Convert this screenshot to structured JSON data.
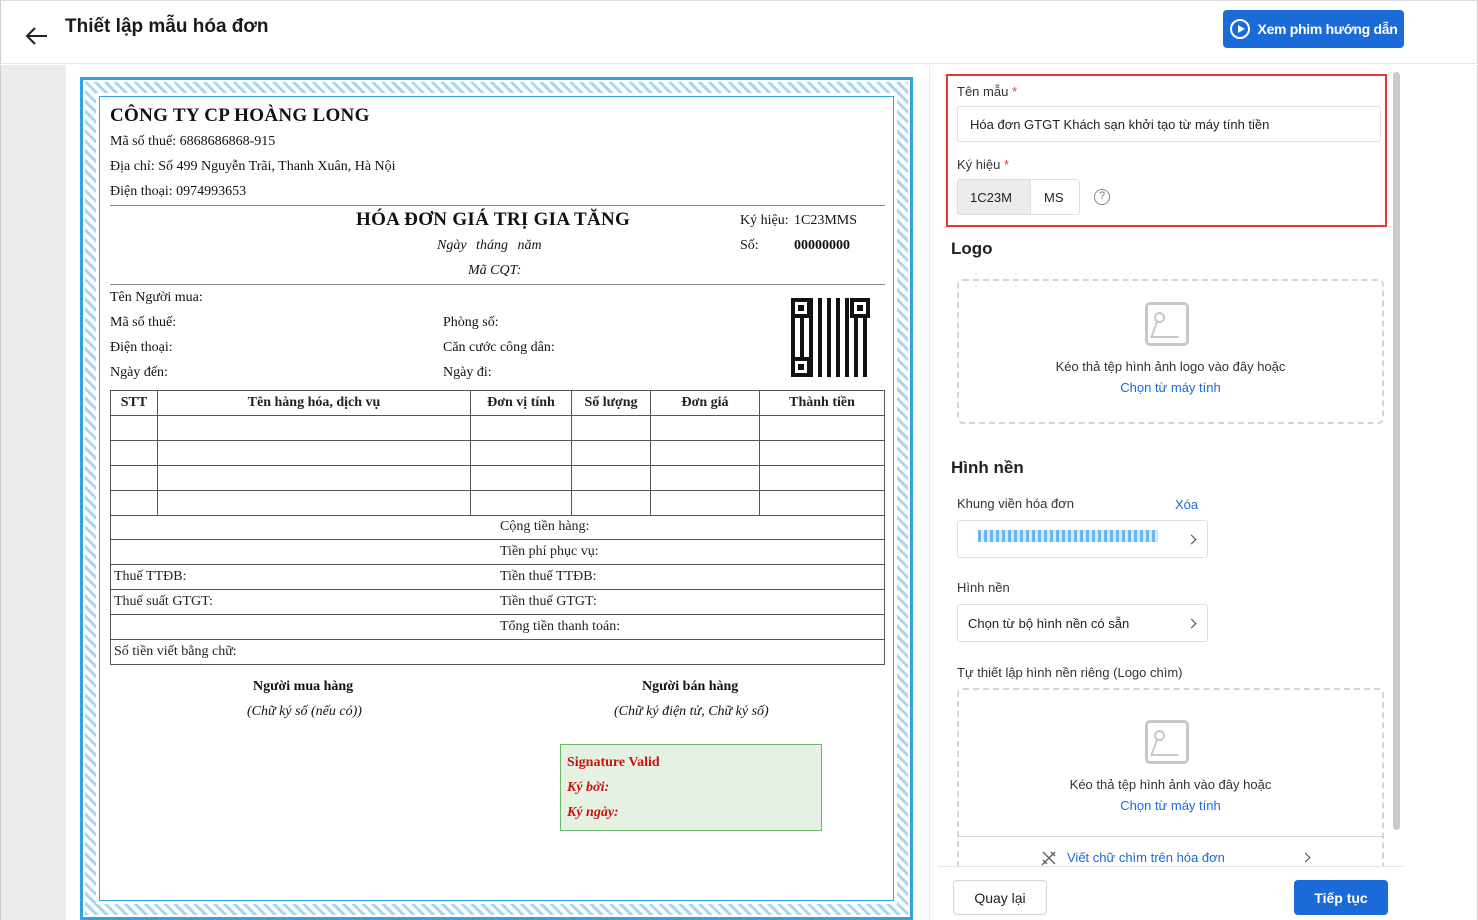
{
  "header": {
    "title": "Thiết lập mẫu hóa đơn",
    "video_button": "Xem phim hướng dẫn"
  },
  "invoice": {
    "company": "CÔNG TY CP HOÀNG LONG",
    "tax_code": "Mã số thuế: 6868686868-915",
    "address": "Địa chỉ: Số 499 Nguyễn Trãi, Thanh Xuân, Hà Nội",
    "phone": "Điện thoại: 0974993653",
    "title": "HÓA ĐƠN GIÁ TRỊ GIA TĂNG",
    "date_line": "Ngày     tháng     năm",
    "cqt_code": "Mã CQT:",
    "symbol_label": "Ký hiệu:",
    "symbol_value": "1C23MMS",
    "number_label": "Số:",
    "number_value": "00000000",
    "buyer_name": "Tên Người mua:",
    "buyer_tax": "Mã số thuế:",
    "buyer_phone": "Điện thoại:",
    "arrival_date": "Ngày đến:",
    "room_no": "Phòng số:",
    "citizen_id": "Căn cước công dân:",
    "departure_date": "Ngày đi:",
    "table_headers": [
      "STT",
      "Tên hàng hóa, dịch vụ",
      "Đơn vị tính",
      "Số lượng",
      "Đơn giá",
      "Thành tiền"
    ],
    "subtotal": "Cộng tiền hàng:",
    "service_fee": "Tiền phí phục vụ:",
    "special_tax": "Thuế TTĐB:",
    "special_tax_amount": "Tiền thuế TTĐB:",
    "vat_rate": "Thuế suất GTGT:",
    "vat_amount": "Tiền thuế GTGT:",
    "total": "Tổng tiền thanh toán:",
    "amount_words": "Số tiền viết bằng chữ:",
    "buyer_sign_title": "Người mua hàng",
    "buyer_sign_note": "(Chữ ký số (nếu có))",
    "seller_sign_title": "Người bán hàng",
    "seller_sign_note": "(Chữ ký điện tử, Chữ ký số)",
    "sig_valid": "Signature Valid",
    "sig_by": "Ký bởi:",
    "sig_date": "Ký ngày:"
  },
  "panel": {
    "template_name_label": "Tên mẫu",
    "template_name_value": "Hóa đơn GTGT Khách sạn khởi tạo từ máy tính tiền",
    "symbol_label": "Ký hiệu",
    "symbol_prefix": "1C23M",
    "symbol_suffix": "MS",
    "required_mark": "*",
    "help_icon": "?",
    "logo_heading": "Logo",
    "logo_drop_text": "Kéo thả tệp hình ảnh logo vào đây hoặc",
    "logo_drop_link": "Chọn từ máy tính",
    "bg_heading": "Hình nền",
    "frame_label": "Khung viền hóa đơn",
    "frame_delete": "Xóa",
    "bg_label": "Hình nền",
    "bg_select": "Chọn từ bộ hình nền có sẵn",
    "watermark_label": "Tự thiết lập hình nền riêng (Logo chìm)",
    "watermark_drop_text": "Kéo thả tệp hình ảnh vào đây hoặc",
    "watermark_drop_link": "Chọn từ máy tính",
    "watermark_text_link": "Viết chữ chìm trên hóa đơn"
  },
  "footer": {
    "back": "Quay lại",
    "next": "Tiếp tục"
  },
  "colors": {
    "accent": "#1a6ad8",
    "highlight": "#e53935",
    "frame": "#2ea3e6"
  }
}
